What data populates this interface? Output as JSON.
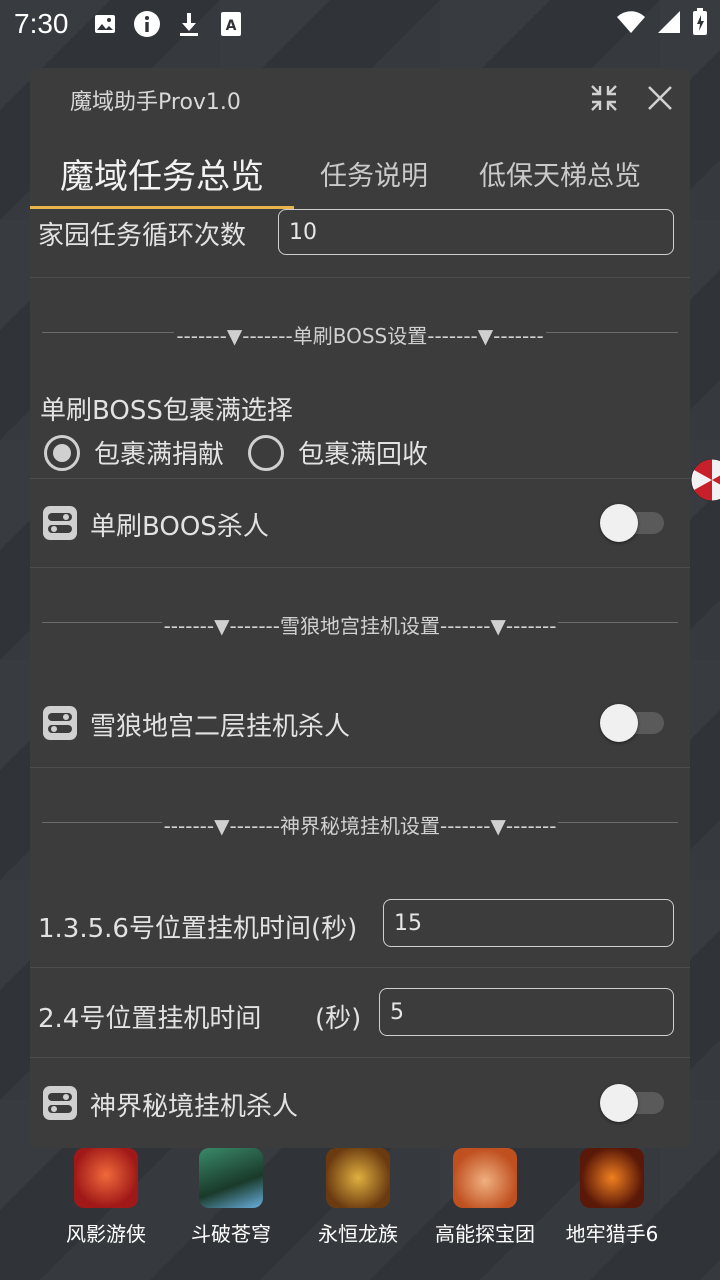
{
  "status_bar": {
    "time": "7:30",
    "left_icons": [
      "image-icon",
      "info-icon",
      "download-icon",
      "a-font-icon"
    ],
    "right_icons": [
      "wifi-icon",
      "cell-signal-icon",
      "battery-charging-icon"
    ]
  },
  "panel": {
    "title": "魔域助手Prov1.0",
    "tabs": [
      {
        "label": "魔域任务总览",
        "active": true
      },
      {
        "label": "任务说明",
        "active": false
      },
      {
        "label": "低保天梯总览",
        "active": false
      }
    ],
    "accent_color": "#e9b54a",
    "home_task": {
      "label": "家园任务循环次数",
      "value": "10"
    },
    "section_boss": "-------▼-------单刷BOSS设置-------▼-------",
    "boss_bag": {
      "label": "单刷BOSS包裹满选择",
      "options": [
        {
          "label": "包裹满捐献",
          "selected": true
        },
        {
          "label": "包裹满回收",
          "selected": false
        }
      ]
    },
    "boss_kill": {
      "label": "单刷BOOS杀人",
      "on": false
    },
    "section_snow": "-------▼-------雪狼地宫挂机设置-------▼-------",
    "snow_kill": {
      "label": "雪狼地宫二层挂机杀人",
      "on": false
    },
    "section_divine": "-------▼-------神界秘境挂机设置-------▼-------",
    "pos1356": {
      "label": "1.3.5.6号位置挂机时间(秒)",
      "value": "15"
    },
    "pos24": {
      "label": "2.4号位置挂机时间",
      "unit": "(秒)",
      "value": "5"
    },
    "divine_kill": {
      "label": "神界秘境挂机杀人",
      "on": false
    }
  },
  "dock": {
    "apps": [
      {
        "name": "风影游侠",
        "color": "#c0262a"
      },
      {
        "name": "斗破苍穹",
        "color": "#2f6a4a"
      },
      {
        "name": "永恒龙族",
        "color": "#a07020"
      },
      {
        "name": "高能探宝团",
        "color": "#c25a20"
      },
      {
        "name": "地牢猎手6",
        "color": "#8a2a10"
      }
    ]
  }
}
